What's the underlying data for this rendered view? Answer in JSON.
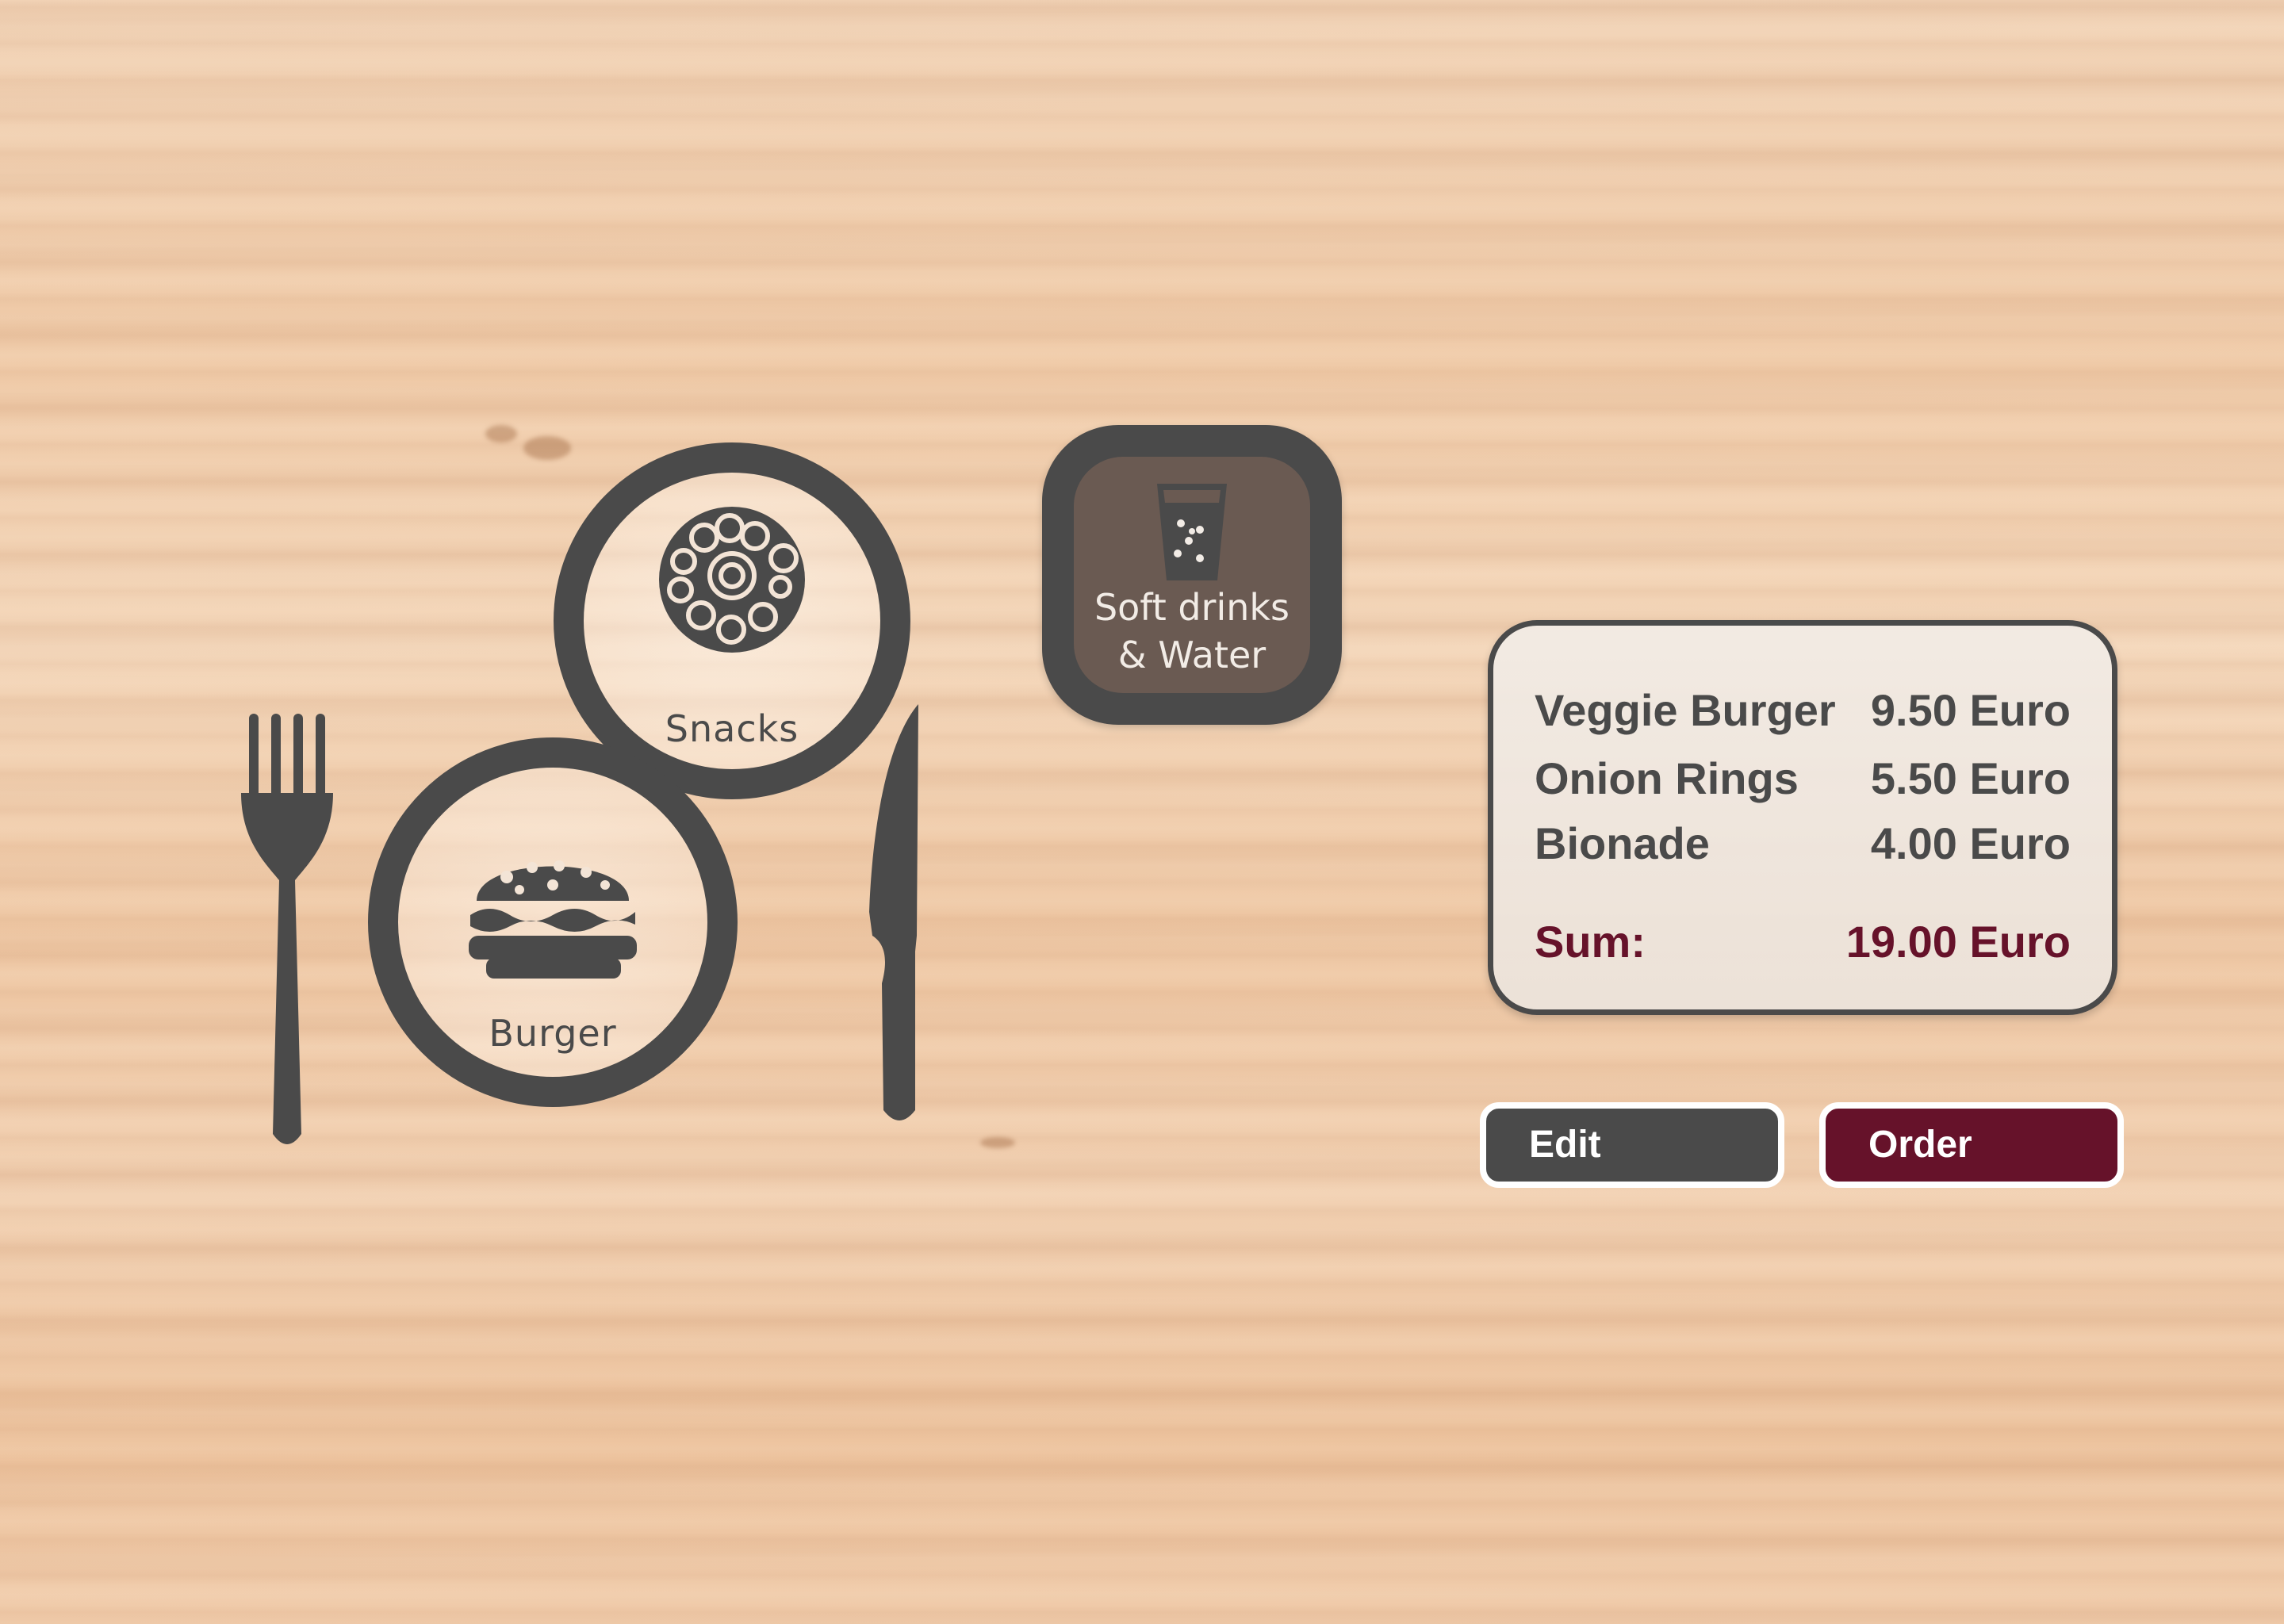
{
  "menu": {
    "categories": [
      {
        "label": "Snacks",
        "icon": "onion-rings-icon"
      },
      {
        "label": "Burger",
        "icon": "burger-icon"
      },
      {
        "label_line1": "Soft drinks",
        "label_line2": "& Water",
        "icon": "glass-icon"
      }
    ]
  },
  "order": {
    "items": [
      {
        "name": "Veggie Burger",
        "price": "9.50 Euro"
      },
      {
        "name": "Onion Rings",
        "price": "5.50 Euro"
      },
      {
        "name": "Bionade",
        "price": "4.00 Euro"
      }
    ],
    "sum_label": "Sum:",
    "sum_value": "19.00 Euro"
  },
  "actions": {
    "edit_label": "Edit",
    "order_label": "Order"
  },
  "colors": {
    "dark": "#4a4a4a",
    "accent": "#66122a",
    "drinks_inner": "#6a5a52"
  }
}
